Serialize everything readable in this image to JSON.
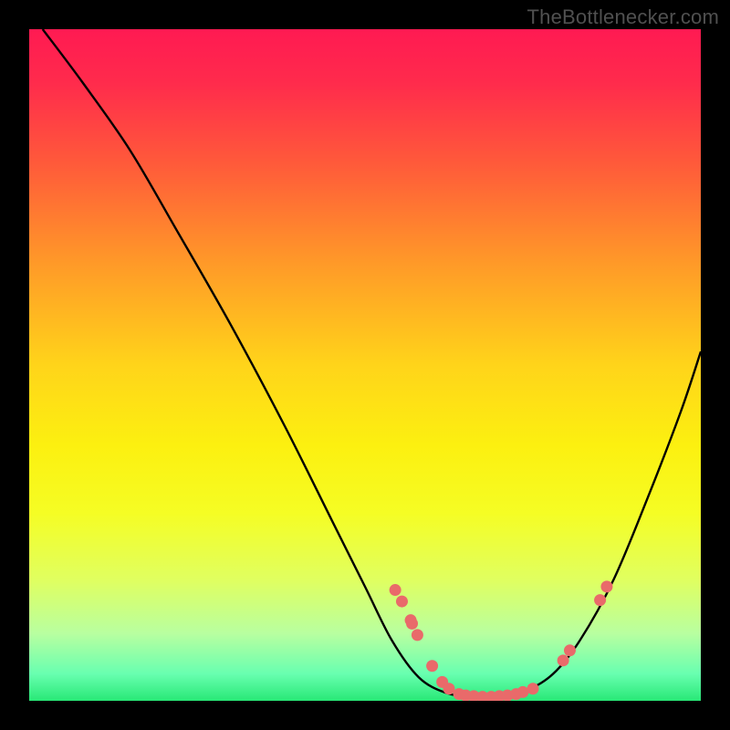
{
  "watermark": "TheBottlenecker.com",
  "chart_data": {
    "type": "line",
    "title": "",
    "xlabel": "",
    "ylabel": "",
    "xlim": [
      0,
      100
    ],
    "ylim": [
      0,
      100
    ],
    "gradient_stops": [
      {
        "offset": 0.0,
        "color": "#ff1a52"
      },
      {
        "offset": 0.08,
        "color": "#ff2b4c"
      },
      {
        "offset": 0.2,
        "color": "#ff5a3a"
      },
      {
        "offset": 0.35,
        "color": "#ff9a28"
      },
      {
        "offset": 0.5,
        "color": "#ffd41a"
      },
      {
        "offset": 0.62,
        "color": "#fcf010"
      },
      {
        "offset": 0.72,
        "color": "#f5fd24"
      },
      {
        "offset": 0.82,
        "color": "#e0ff60"
      },
      {
        "offset": 0.9,
        "color": "#b8ffa0"
      },
      {
        "offset": 0.96,
        "color": "#68ffb0"
      },
      {
        "offset": 1.0,
        "color": "#28e876"
      }
    ],
    "curve": [
      {
        "x": 2,
        "y": 100
      },
      {
        "x": 8,
        "y": 92
      },
      {
        "x": 15,
        "y": 82
      },
      {
        "x": 22,
        "y": 70
      },
      {
        "x": 30,
        "y": 56
      },
      {
        "x": 38,
        "y": 41
      },
      {
        "x": 45,
        "y": 27
      },
      {
        "x": 50,
        "y": 17
      },
      {
        "x": 54,
        "y": 9
      },
      {
        "x": 58,
        "y": 3.5
      },
      {
        "x": 62,
        "y": 1.2
      },
      {
        "x": 66,
        "y": 0.6
      },
      {
        "x": 70,
        "y": 0.6
      },
      {
        "x": 74,
        "y": 1.5
      },
      {
        "x": 78,
        "y": 4
      },
      {
        "x": 82,
        "y": 9
      },
      {
        "x": 87,
        "y": 18
      },
      {
        "x": 92,
        "y": 30
      },
      {
        "x": 97,
        "y": 43
      },
      {
        "x": 100,
        "y": 52
      }
    ],
    "scatter_points": [
      {
        "x": 54.5,
        "y": 16.5
      },
      {
        "x": 55.5,
        "y": 14.8
      },
      {
        "x": 56.8,
        "y": 12.0
      },
      {
        "x": 57.0,
        "y": 11.5
      },
      {
        "x": 57.8,
        "y": 9.8
      },
      {
        "x": 60.0,
        "y": 5.2
      },
      {
        "x": 61.5,
        "y": 2.8
      },
      {
        "x": 62.5,
        "y": 1.8
      },
      {
        "x": 64.0,
        "y": 1.0
      },
      {
        "x": 65.0,
        "y": 0.8
      },
      {
        "x": 66.2,
        "y": 0.7
      },
      {
        "x": 67.5,
        "y": 0.6
      },
      {
        "x": 68.8,
        "y": 0.6
      },
      {
        "x": 70.0,
        "y": 0.7
      },
      {
        "x": 71.2,
        "y": 0.8
      },
      {
        "x": 72.5,
        "y": 1.0
      },
      {
        "x": 73.5,
        "y": 1.3
      },
      {
        "x": 75.0,
        "y": 1.8
      },
      {
        "x": 79.5,
        "y": 6.0
      },
      {
        "x": 80.5,
        "y": 7.5
      },
      {
        "x": 85.0,
        "y": 15.0
      },
      {
        "x": 86.0,
        "y": 17.0
      }
    ],
    "point_color": "#e96a6a",
    "curve_color": "#000000"
  }
}
